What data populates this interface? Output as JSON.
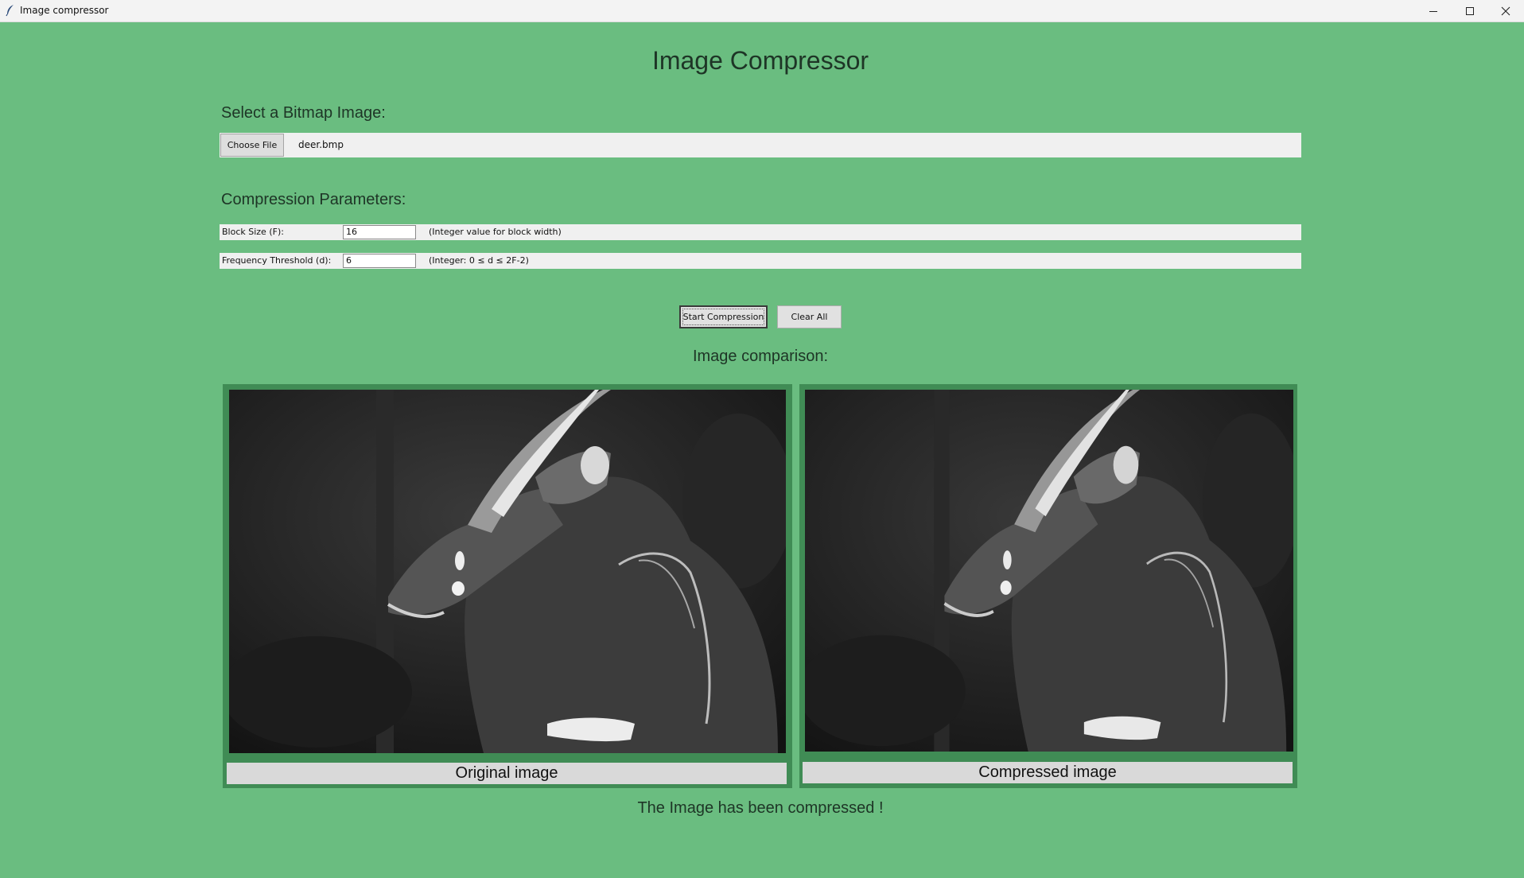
{
  "window": {
    "title": "Image compressor",
    "icons": [
      "feather-icon",
      "minimize-icon",
      "maximize-icon",
      "close-icon"
    ]
  },
  "app": {
    "heading": "Image Compressor",
    "background_color": "#6abd80",
    "panel_border_color": "#408c55"
  },
  "file_section": {
    "label": "Select a Bitmap Image:",
    "choose_label": "Choose File",
    "file_name": "deer.bmp"
  },
  "params_section": {
    "label": "Compression Parameters:",
    "params": [
      {
        "label": "Block Size (F):",
        "value": "16",
        "hint": "(Integer value for block width)"
      },
      {
        "label": "Frequency Threshold (d):",
        "value": "6",
        "hint": "(Integer: 0 ≤ d ≤ 2F-2)"
      }
    ]
  },
  "actions": {
    "start_label": "Start Compression",
    "clear_label": "Clear All"
  },
  "comparison": {
    "label": "Image comparison:",
    "original_caption": "Original image",
    "compressed_caption": "Compressed image"
  },
  "status": {
    "message": "The Image has been compressed !"
  }
}
